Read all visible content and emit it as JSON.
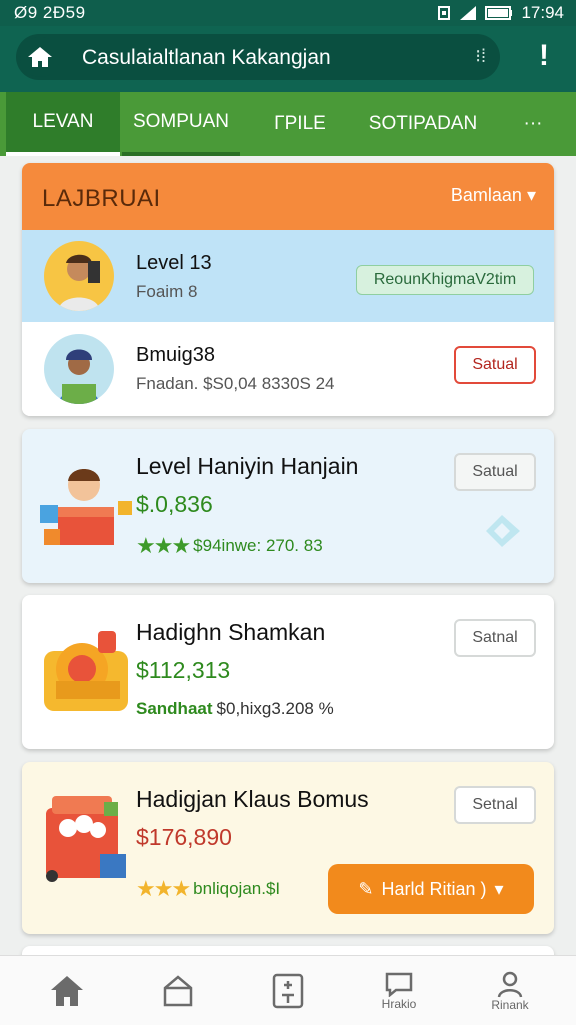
{
  "status": {
    "left": "Ø9 2Ð59",
    "time": "17:94"
  },
  "appbar": {
    "url": "Casulaialtlanan Kakangjan",
    "menu": "!"
  },
  "tabs": [
    {
      "label": "LEVAN"
    },
    {
      "label": "SOMPUAN"
    },
    {
      "label": "ΓΡΙLΕ"
    },
    {
      "label": "SOTIPADAN"
    },
    {
      "label": "···"
    }
  ],
  "leaderboard": {
    "title": "LAJBRUAI",
    "dropdown": "Bamlaan",
    "rows": [
      {
        "title": "Level 13",
        "subtitle": "Foaim 8",
        "badge": "ReounKhigmaV2tim"
      },
      {
        "title": "Bmuig38",
        "subtitle": "Fnadan. $S0,04 8330S 24",
        "badge": "Satual"
      }
    ]
  },
  "offers": [
    {
      "title": "Level Haniyin Hanjain",
      "price": "$.0,836",
      "meta": "$94inwe: 270. 83",
      "badge": "Satual",
      "price_color": "#2e8a1e"
    },
    {
      "title": "Hadighn Shamkan",
      "price": "$112,313",
      "meta_label": "Sandhaat",
      "meta": "$0,hixg3.208  %",
      "badge": "Satnal",
      "price_color": "#2e8a1e"
    },
    {
      "title": "Hadigjan Klaus Bomus",
      "price": "$176,890",
      "meta": "bnliqojan.$I",
      "badge": "Setnal",
      "button": "Harld Ritian )",
      "price_color": "#c0392b"
    }
  ],
  "nav": [
    {
      "icon": "home-icon",
      "label": ""
    },
    {
      "icon": "box-icon",
      "label": ""
    },
    {
      "icon": "calculator-icon",
      "label": ""
    },
    {
      "icon": "chat-icon",
      "label": "Hrakio"
    },
    {
      "icon": "profile-icon",
      "label": "Rinank"
    }
  ]
}
